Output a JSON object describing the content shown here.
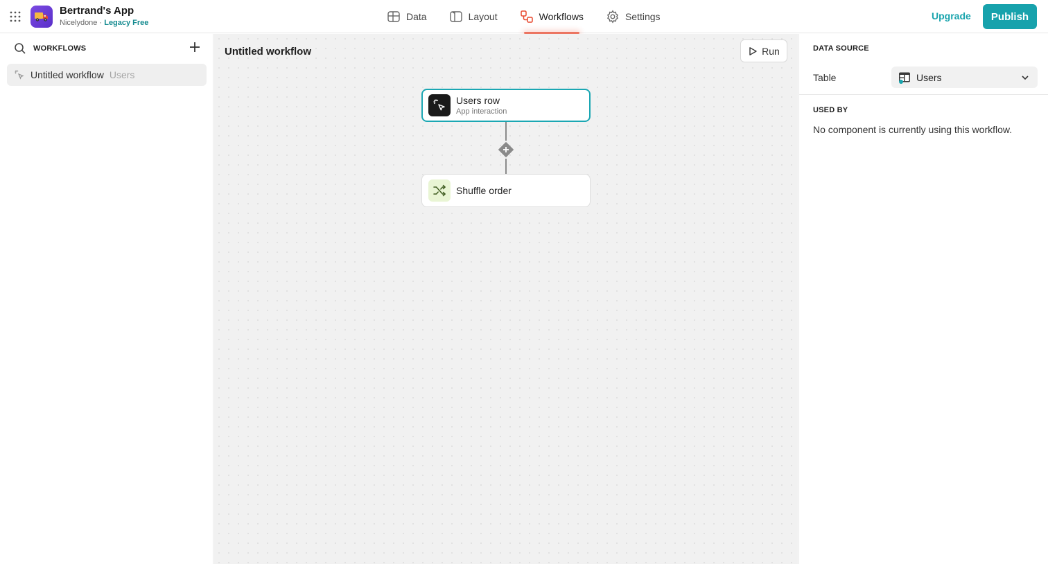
{
  "topbar": {
    "app_name": "Bertrand's App",
    "workspace": "Nicelydone",
    "separator": "·",
    "plan": "Legacy Free",
    "nav": [
      {
        "label": "Data",
        "icon": "table-icon"
      },
      {
        "label": "Layout",
        "icon": "layout-icon"
      },
      {
        "label": "Workflows",
        "icon": "workflows-icon",
        "active": true
      },
      {
        "label": "Settings",
        "icon": "gear-icon"
      }
    ],
    "upgrade_label": "Upgrade",
    "publish_label": "Publish",
    "accent_color": "#17a2ac",
    "active_tab_color": "#e8492f"
  },
  "sidebar": {
    "title": "WORKFLOWS",
    "items": [
      {
        "label": "Untitled workflow",
        "table": "Users",
        "selected": true
      }
    ]
  },
  "canvas": {
    "title": "Untitled workflow",
    "run_label": "Run",
    "trigger": {
      "title": "Users row",
      "subtitle": "App interaction"
    },
    "steps": [
      {
        "title": "Shuffle order"
      }
    ]
  },
  "panel": {
    "data_source_heading": "DATA SOURCE",
    "table_label": "Table",
    "table_value": "Users",
    "used_by_heading": "USED BY",
    "used_by_empty": "No component is currently using this workflow."
  }
}
